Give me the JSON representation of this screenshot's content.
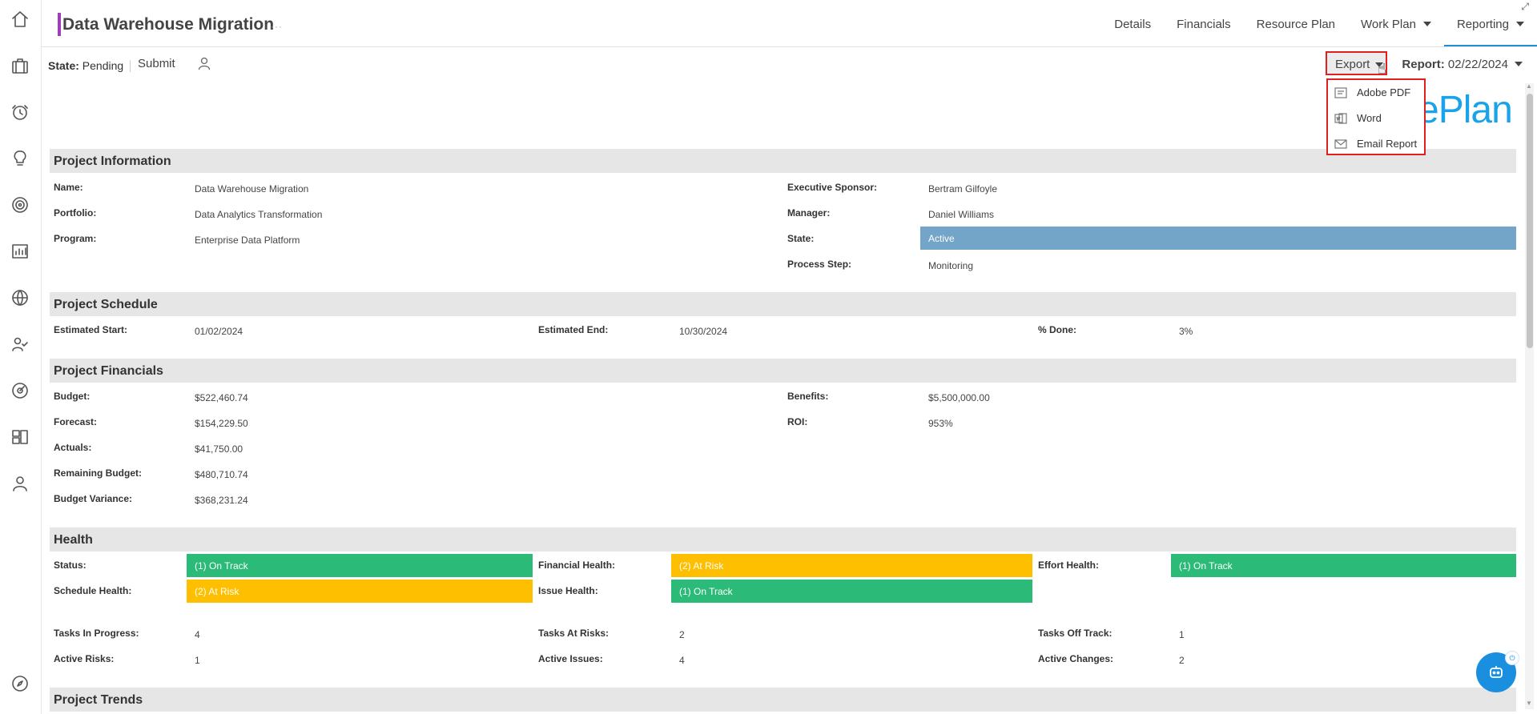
{
  "header": {
    "title": "Data Warehouse Migration",
    "title_more": "···",
    "tabs": [
      {
        "label": "Details",
        "has_caret": false
      },
      {
        "label": "Financials",
        "has_caret": false
      },
      {
        "label": "Resource Plan",
        "has_caret": false
      },
      {
        "label": "Work Plan",
        "has_caret": true
      },
      {
        "label": "Reporting",
        "has_caret": true,
        "active": true
      }
    ],
    "expand_icon": "⤢"
  },
  "toolbar": {
    "state_label": "State:",
    "state_value": "Pending",
    "submit_label": "Submit",
    "export_label": "Export",
    "report_label": "Report:",
    "report_value": "02/22/2024"
  },
  "export_menu": {
    "items": [
      {
        "label": "Adobe PDF",
        "icon": "pdf-icon"
      },
      {
        "label": "Word",
        "icon": "word-icon"
      },
      {
        "label": "Email Report",
        "icon": "email-icon"
      }
    ]
  },
  "logo_text": "ePlan",
  "project_information": {
    "title": "Project Information",
    "left": [
      {
        "label": "Name:",
        "value": "Data Warehouse Migration"
      },
      {
        "label": "Portfolio:",
        "value": "Data Analytics Transformation"
      },
      {
        "label": "Program:",
        "value": "Enterprise Data Platform"
      }
    ],
    "right": [
      {
        "label": "Executive Sponsor:",
        "value": "Bertram Gilfoyle"
      },
      {
        "label": "Manager:",
        "value": "Daniel Williams"
      },
      {
        "label": "State:",
        "value": "Active"
      },
      {
        "label": "Process Step:",
        "value": "Monitoring"
      }
    ]
  },
  "project_schedule": {
    "title": "Project Schedule",
    "items": [
      {
        "label": "Estimated Start:",
        "value": "01/02/2024"
      },
      {
        "label": "Estimated End:",
        "value": "10/30/2024"
      },
      {
        "label": "% Done:",
        "value": "3%"
      }
    ]
  },
  "project_financials": {
    "title": "Project Financials",
    "left": [
      {
        "label": "Budget:",
        "value": "$522,460.74"
      },
      {
        "label": "Forecast:",
        "value": "$154,229.50"
      },
      {
        "label": "Actuals:",
        "value": "$41,750.00"
      },
      {
        "label": "Remaining Budget:",
        "value": "$480,710.74"
      },
      {
        "label": "Budget Variance:",
        "value": "$368,231.24"
      }
    ],
    "right": [
      {
        "label": "Benefits:",
        "value": "$5,500,000.00"
      },
      {
        "label": "ROI:",
        "value": "953%"
      }
    ]
  },
  "health": {
    "title": "Health",
    "indicators": [
      {
        "label": "Status:",
        "value": "(1) On Track",
        "color": "#2bba77"
      },
      {
        "label": "Financial Health:",
        "value": "(2) At Risk",
        "color": "#fdbf00"
      },
      {
        "label": "Effort Health:",
        "value": "(1) On Track",
        "color": "#2bba77"
      },
      {
        "label": "Schedule Health:",
        "value": "(2) At Risk",
        "color": "#fdbf00"
      },
      {
        "label": "Issue Health:",
        "value": "(1) On Track",
        "color": "#2bba77"
      }
    ],
    "counts": [
      {
        "label": "Tasks In Progress:",
        "value": "4"
      },
      {
        "label": "Tasks At Risks:",
        "value": "2"
      },
      {
        "label": "Tasks Off Track:",
        "value": "1"
      },
      {
        "label": "Active Risks:",
        "value": "1"
      },
      {
        "label": "Active Issues:",
        "value": "4"
      },
      {
        "label": "Active Changes:",
        "value": "2"
      }
    ]
  },
  "project_trends": {
    "title": "Project Trends"
  },
  "colors": {
    "accent": "#9c3fb8",
    "active_tab": "#1f8fd4",
    "on_track": "#2bba77",
    "at_risk": "#fdbf00",
    "state_active": "#72a5c8",
    "logo": "#1aa3e8",
    "highlight_border": "#e02020"
  }
}
